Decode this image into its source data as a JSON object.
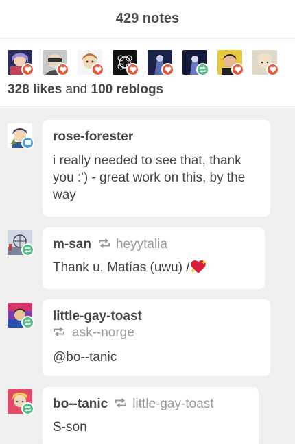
{
  "header": {
    "title": "429 notes"
  },
  "summary": {
    "likes_count": "328 likes",
    "and_text": "and",
    "reblogs_count": "100 reblogs",
    "avatars": [
      {
        "badge": "like"
      },
      {
        "badge": "like"
      },
      {
        "badge": "like"
      },
      {
        "badge": "like"
      },
      {
        "badge": "like"
      },
      {
        "badge": "reblog"
      },
      {
        "badge": "like"
      },
      {
        "badge": "like"
      }
    ]
  },
  "notes": [
    {
      "type": "reply",
      "username": "rose-forester",
      "text": "i really needed to see that, thank you :') - great work on this, by the way"
    },
    {
      "type": "reblog",
      "username": "m-san",
      "source": "heyytalia",
      "text": "Thank u, Matías (uwu) /"
    },
    {
      "type": "reblog",
      "username": "little-gay-toast",
      "source": "ask--norge",
      "text": "@bo--tanic"
    },
    {
      "type": "reblog",
      "username": "bo--tanic",
      "source": "little-gay-toast",
      "text": "S-son"
    }
  ],
  "colors": {
    "like": "#e1583c",
    "reblog": "#56bc8a",
    "reply": "#529ecc",
    "background": "#efefef"
  },
  "icons": {
    "like_badge": "heart-icon",
    "reblog_badge": "reblog-icon",
    "reply_badge": "speech-bubble-icon",
    "inline_reblog": "reblog-arrows-icon",
    "emoji": "sparkling-heart-emoji"
  }
}
